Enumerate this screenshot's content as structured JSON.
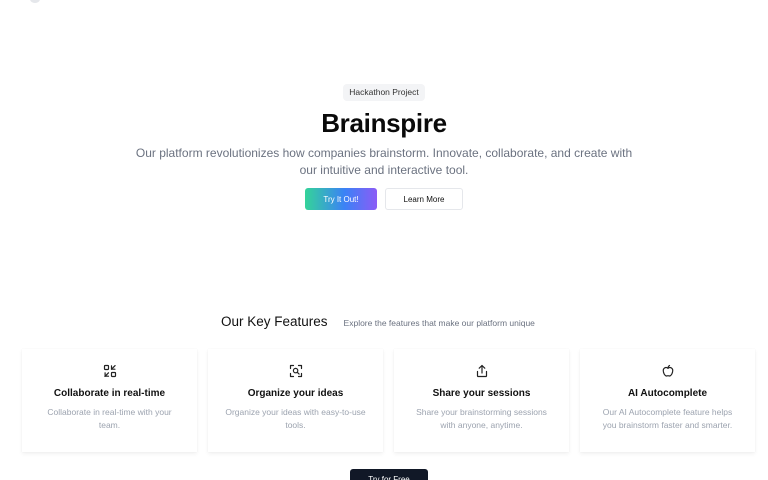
{
  "hero": {
    "badge": "Hackathon Project",
    "title": "Brainspire",
    "description": "Our platform revolutionizes how companies brainstorm. Innovate, collaborate, and create with our intuitive and interactive tool.",
    "primary_button": "Try It Out!",
    "secondary_button": "Learn More",
    "primary_gradient": [
      "#34d399",
      "#3b82f6",
      "#8b5cf6"
    ]
  },
  "features": {
    "title": "Our Key Features",
    "subtitle": "Explore the features that make our platform unique",
    "cards": [
      {
        "icon": "collaborate-icon",
        "title": "Collaborate in real-time",
        "description": "Collaborate in real-time with your team."
      },
      {
        "icon": "organize-icon",
        "title": "Organize your ideas",
        "description": "Organize your ideas with easy-to-use tools."
      },
      {
        "icon": "share-icon",
        "title": "Share your sessions",
        "description": "Share your brainstorming sessions with anyone, anytime."
      },
      {
        "icon": "apple-icon",
        "title": "AI Autocomplete",
        "description": "Our AI Autocomplete feature helps you brainstorm faster and smarter."
      }
    ]
  },
  "cta": {
    "label": "Try for Free",
    "color": "#111827"
  }
}
